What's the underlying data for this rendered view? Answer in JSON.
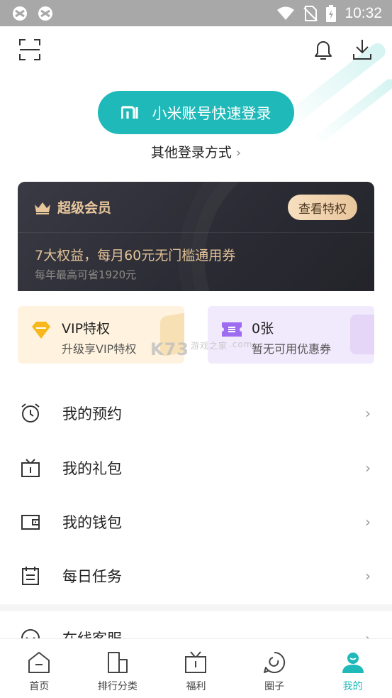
{
  "status_bar": {
    "time": "10:32"
  },
  "header": {
    "scan_icon": "scan-icon",
    "bell_icon": "bell-icon",
    "download_icon": "download-icon"
  },
  "login": {
    "button_label": "小米账号快速登录",
    "other_label": "其他登录方式",
    "chevron": "›"
  },
  "vip_card": {
    "title": "超级会员",
    "button": "查看特权",
    "benefit": "7大权益，每月60元无门槛通用券",
    "saving": "每年最高可省1920元",
    "accent": "#e3c397"
  },
  "promos": [
    {
      "title": "VIP特权",
      "subtitle": "升级享VIP特权",
      "icon": "diamond-icon"
    },
    {
      "title": "0张",
      "subtitle": "暂无可用优惠券",
      "icon": "coupon-icon"
    }
  ],
  "watermark": {
    "text": "K73",
    "sub": "游戏之家",
    "domain": ".com"
  },
  "menu": [
    {
      "label": "我的预约",
      "icon": "alarm-clock-icon"
    },
    {
      "label": "我的礼包",
      "icon": "gift-icon"
    },
    {
      "label": "我的钱包",
      "icon": "wallet-icon"
    },
    {
      "label": "每日任务",
      "icon": "calendar-icon"
    },
    {
      "label": "在线客服",
      "icon": "chat-icon"
    }
  ],
  "menu_chevron": "›",
  "bottom_nav": [
    {
      "label": "首页",
      "icon": "home-icon",
      "active": false
    },
    {
      "label": "排行分类",
      "icon": "ranking-icon",
      "active": false
    },
    {
      "label": "福利",
      "icon": "gift-box-icon",
      "active": false
    },
    {
      "label": "圈子",
      "icon": "community-icon",
      "active": false
    },
    {
      "label": "我的",
      "icon": "profile-icon",
      "active": true
    }
  ],
  "colors": {
    "brand": "#1fb9b9",
    "vip_gold": "#e8c79b",
    "vip_bg": "#2a2a33"
  }
}
